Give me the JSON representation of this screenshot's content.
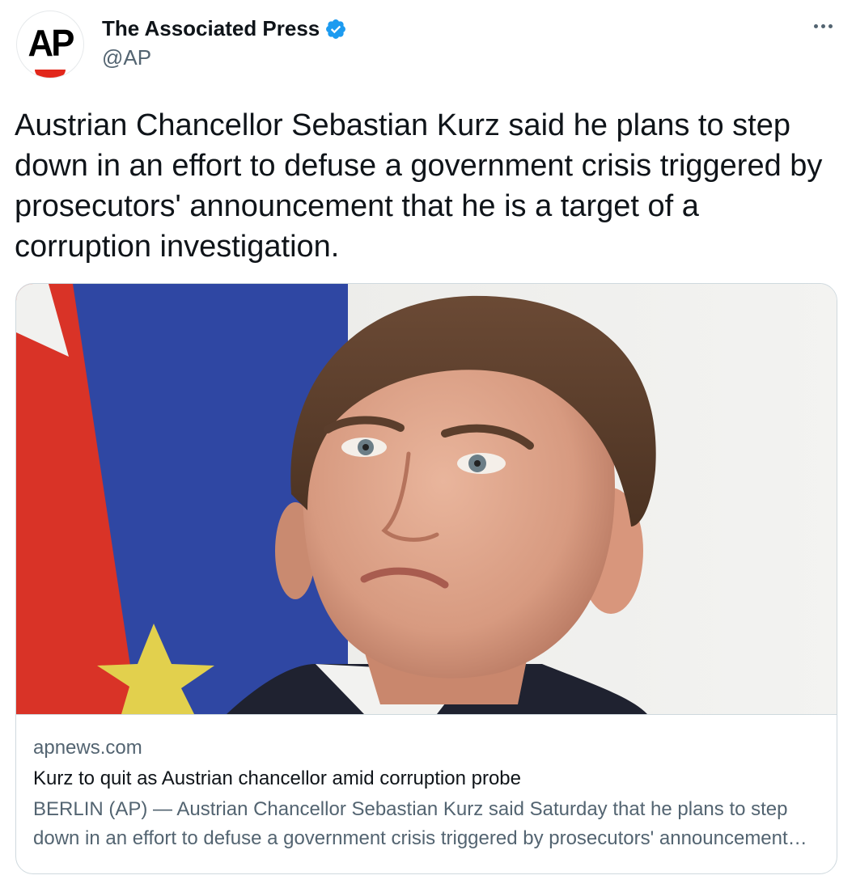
{
  "account": {
    "display_name": "The Associated Press",
    "handle": "@AP",
    "avatar_text": "AP",
    "verified_icon": "verified-badge-icon",
    "brand_color": "#e2271b",
    "verified_color": "#1d9bf0"
  },
  "tweet": {
    "text": "Austrian Chancellor Sebastian Kurz said he plans to step down in an effort to defuse a government crisis triggered by prosecutors' announcement that he is a target of a corruption investigation."
  },
  "card": {
    "domain": "apnews.com",
    "title": "Kurz to quit as Austrian chancellor amid corruption probe",
    "description": "BERLIN (AP) — Austrian Chancellor Sebastian Kurz said Saturday that he plans to step down in an effort to defuse a government crisis triggered by prosecutors' announcement that he is a target of a corruption investigation."
  },
  "menu": {
    "icon": "more-options-icon"
  }
}
